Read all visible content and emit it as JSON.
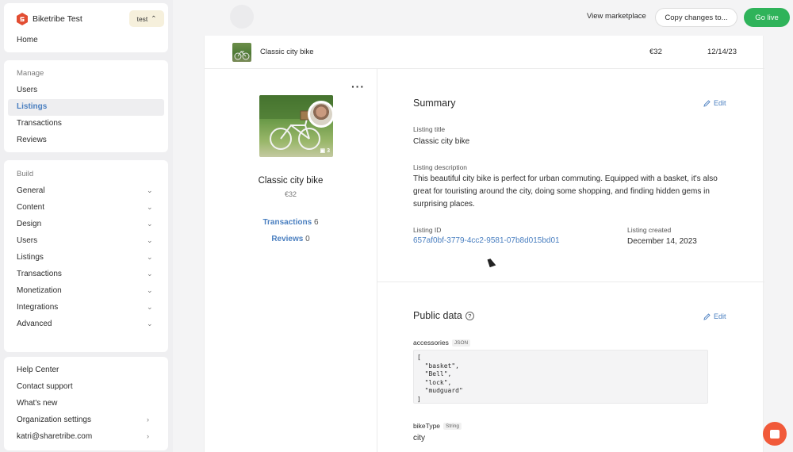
{
  "app": {
    "name": "Biketribe Test",
    "environment": "test"
  },
  "colors": {
    "accent": "#4a7fc0",
    "go_live": "#2fb35a",
    "brand": "#e24d32",
    "chat": "#f15a3a"
  },
  "sidebar": {
    "home": "Home",
    "manage_title": "Manage",
    "manage_items": [
      "Users",
      "Listings",
      "Transactions",
      "Reviews"
    ],
    "active_item": "Listings",
    "build_title": "Build",
    "build_items": [
      "General",
      "Content",
      "Design",
      "Users",
      "Listings",
      "Transactions",
      "Monetization",
      "Integrations",
      "Advanced"
    ],
    "bottom_items": [
      "Help Center",
      "Contact support",
      "What's new",
      "Organization settings",
      "katri@sharetribe.com"
    ]
  },
  "topbar": {
    "view_marketplace": "View marketplace",
    "copy_changes": "Copy changes to...",
    "go_live": "Go live"
  },
  "listing_row": {
    "title": "Classic city bike",
    "price": "€32",
    "date": "12/14/23"
  },
  "listing_panel": {
    "title": "Classic city bike",
    "price": "€32",
    "image_count": "3",
    "transactions_label": "Transactions",
    "transactions_count": "6",
    "reviews_label": "Reviews",
    "reviews_count": "0"
  },
  "summary": {
    "heading": "Summary",
    "edit": "Edit",
    "title_label": "Listing title",
    "title_value": "Classic city bike",
    "description_label": "Listing description",
    "description_value": "This beautiful city bike is perfect for urban commuting. Equipped with a basket, it's also great for touristing around the city, doing some shopping, and finding hidden gems in surprising places.",
    "id_label": "Listing ID",
    "id_value": "657af0bf-3779-4cc2-9581-07b8d015bd01",
    "created_label": "Listing created",
    "created_value": "December 14, 2023"
  },
  "public_data": {
    "heading": "Public data",
    "edit": "Edit",
    "accessories_key": "accessories",
    "accessories_type": "JSON",
    "accessories_value": "[\n  \"basket\",\n  \"Bell\",\n  \"lock\",\n  \"mudguard\"\n]",
    "bike_type_key": "bikeType",
    "bike_type_type": "String",
    "bike_type_value": "city"
  }
}
